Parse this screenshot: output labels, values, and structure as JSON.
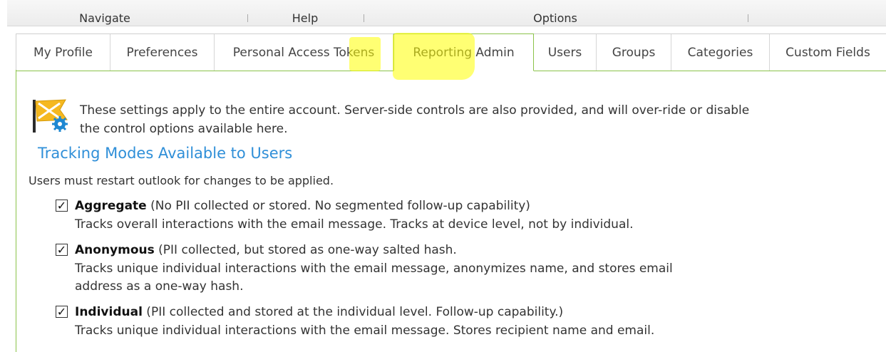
{
  "menu": {
    "items": [
      "Navigate",
      "Help",
      "Options"
    ]
  },
  "tabs": [
    {
      "label": "My Profile"
    },
    {
      "label": "Preferences"
    },
    {
      "label": "Personal Access Tokens"
    },
    {
      "label": "Reporting Admin",
      "active": true
    },
    {
      "label": "Users"
    },
    {
      "label": "Groups"
    },
    {
      "label": "Categories"
    },
    {
      "label": "Custom Fields"
    }
  ],
  "content": {
    "intro": "These settings apply to the entire account. Server-side controls are also provided, and will over-ride or disable the control options available here.",
    "heading": "Tracking Modes Available to Users",
    "note": "Users must restart outlook for changes to be applied.",
    "options": [
      {
        "name": "Aggregate",
        "detail": " (No PII collected or stored. No segmented follow-up capability)",
        "description": "Tracks overall interactions with the email message. Tracks at device level, not by individual.",
        "checked": true
      },
      {
        "name": "Anonymous",
        "detail": " (PII collected, but stored as one-way salted hash.",
        "description": "Tracks unique individual interactions with the email message, anonymizes name, and stores email address as a one-way hash.",
        "checked": true
      },
      {
        "name": "Individual",
        "detail": " (PII collected and stored at the individual level. Follow-up capability.)",
        "description": "Tracks unique individual interactions with the email message. Stores recipient name and email.",
        "checked": true
      }
    ]
  },
  "colors": {
    "accent_green": "#8bc34a",
    "heading_blue": "#2f8fd8",
    "highlight": "#ffff00"
  },
  "icons": {
    "flag": "flag-settings-icon",
    "checkbox_checked": "checkbox-checked-icon"
  }
}
